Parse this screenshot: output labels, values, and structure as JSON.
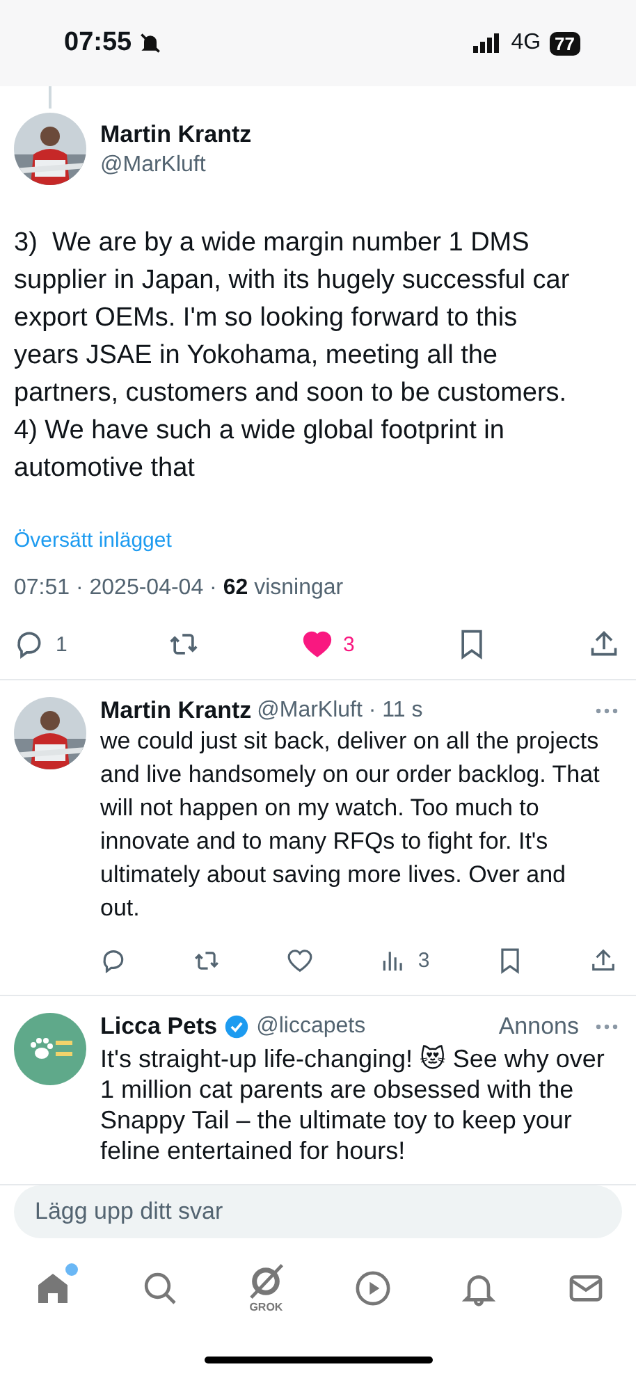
{
  "status_bar": {
    "time": "07:55",
    "silenced": true,
    "network": "4G",
    "battery": "77"
  },
  "tweet": {
    "author": "Martin Krantz",
    "handle": "@MarKluft",
    "thread_above": true,
    "text": "3)  We are by a wide margin number 1 DMS supplier in Japan, with its hugely successful car export OEMs. I'm so looking forward to this years JSAE in Yokohama, meeting all the partners, customers and soon to be customers. 4) We have such a wide global footprint in automotive that",
    "translate_link": "Översätt inlägget",
    "meta": {
      "timestamp": "07:51 · 2025-04-04 ·",
      "views": "62",
      "views_label": "visningar"
    },
    "actions": [
      {
        "kind": "reply",
        "count": "1",
        "active": false
      },
      {
        "kind": "repost",
        "active": false
      },
      {
        "kind": "like",
        "count": "3",
        "active": true
      },
      {
        "kind": "bookmark",
        "active": false
      },
      {
        "kind": "share",
        "active": false
      }
    ]
  },
  "replies": [
    {
      "author": "Martin Krantz",
      "handle_line": "@MarKluft · 11 s",
      "text": "we could just sit back, deliver on all the projects and live handsomely on our order backlog. That will not happen on my watch. Too much to innovate and to many RFQs to fight for. It's ultimately about saving more lives. Over and out.",
      "actions": [
        {
          "kind": "reply",
          "active": false
        },
        {
          "kind": "repost",
          "active": false
        },
        {
          "kind": "like",
          "active": false
        },
        {
          "kind": "views",
          "count": "3",
          "active": false
        },
        {
          "kind": "bookmark",
          "active": false
        },
        {
          "kind": "share",
          "active": false
        }
      ]
    }
  ],
  "ad": {
    "author": "Licca Pets",
    "verified": true,
    "handle": "@liccapets",
    "label": "Annons",
    "text": "It's straight-up life-changing! 😻 See why over 1 million cat parents are obsessed with the Snappy Tail – the ultimate toy to keep your feline entertained for hours!"
  },
  "composer": {
    "placeholder": "Lägg upp ditt svar"
  },
  "tab_bar": [
    {
      "kind": "home",
      "selected": true,
      "badge": true
    },
    {
      "kind": "search",
      "selected": false,
      "badge": false
    },
    {
      "kind": "grok",
      "label": "GROK",
      "selected": false,
      "badge": false
    },
    {
      "kind": "video",
      "selected": false,
      "badge": false
    },
    {
      "kind": "notifications",
      "selected": false,
      "badge": false
    },
    {
      "kind": "messages",
      "selected": false,
      "badge": false
    }
  ]
}
